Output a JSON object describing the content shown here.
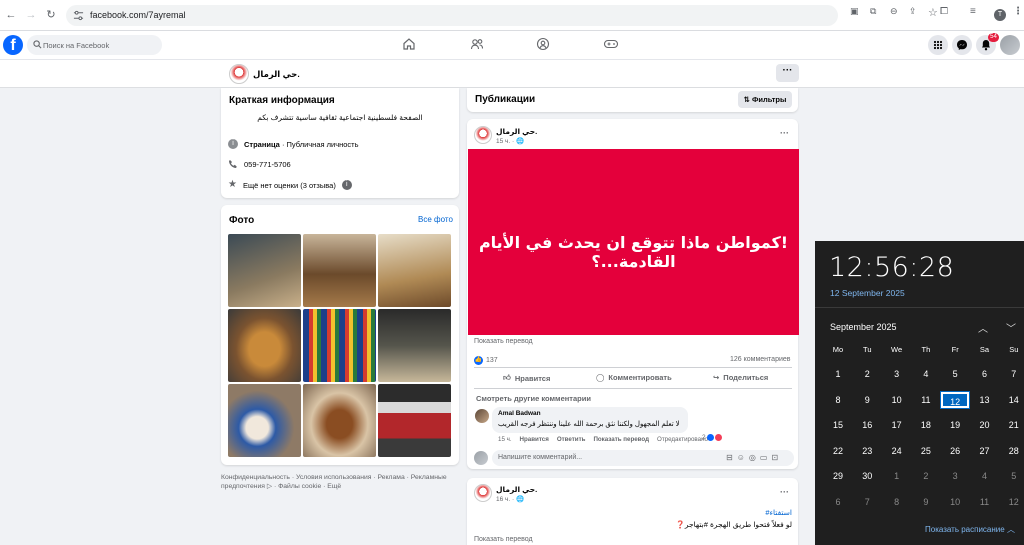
{
  "browser": {
    "url": "facebook.com/7ayremal",
    "profile_initial": "T"
  },
  "fb": {
    "search_placeholder": "Поиск на Facebook",
    "notifications_count": "54"
  },
  "page": {
    "name": "حي الرمال.",
    "more_label": "···"
  },
  "intro": {
    "title": "Краткая информация",
    "description": "الصفحة فلسطينية اجتماعية ثقافية ساسية تتشرف بكم",
    "category_bold": "Страница",
    "category_rest": " · Публичная личность",
    "phone": "059-771-5706",
    "rating": "Ещё нет оценки (3 отзыва)"
  },
  "photos": {
    "title": "Фото",
    "see_all": "Все фото"
  },
  "footer": {
    "text": "Конфиденциальность · Условия использования · Реклама · Рекламные предпочтения ▷ · Файлы cookie · Ещё"
  },
  "posts_header": {
    "title": "Публикации",
    "filters": "Фильтры"
  },
  "post1": {
    "author": "حي الرمال.",
    "time": "15 ч. · ",
    "banner_text": "!كمواطن ماذا تتوقع ان يحدث في الأيام القادمة...؟",
    "translate": "Показать перевод",
    "reactions": "137",
    "comments_count": "126 комментариев",
    "like": "Нравится",
    "comment": "Комментировать",
    "share": "Поделиться",
    "more_comments": "Смотреть другие комментарии",
    "comment_author": "Amal Badwan",
    "comment_text": "لا تعلم المجهول ولكننا نثق برحمة الله علينا وننتظر فرجه القريب",
    "comment_time": "15 ч.",
    "comment_like": "Нравится",
    "comment_reply": "Ответить",
    "comment_translate": "Показать перевод",
    "comment_edited": "Отредактировано",
    "comment_reacts": "2",
    "write_comment": "Напишите комментарий..."
  },
  "post2": {
    "author": "حي الرمال.",
    "time": "16 ч. · ",
    "hashtag": "#استفتاء",
    "text": "لو فعلاً فتحوا طريق الهجرة #بتهاجر❓",
    "translate": "Показать перевод"
  },
  "clock": {
    "time": "12:56:28",
    "date": "12 September 2025",
    "month": "September 2025",
    "weekdays": [
      "Mo",
      "Tu",
      "We",
      "Th",
      "Fr",
      "Sa",
      "Su"
    ],
    "rows": [
      [
        "1",
        "2",
        "3",
        "4",
        "5",
        "6",
        "7"
      ],
      [
        "8",
        "9",
        "10",
        "11",
        "12",
        "13",
        "14"
      ],
      [
        "15",
        "16",
        "17",
        "18",
        "19",
        "20",
        "21"
      ],
      [
        "22",
        "23",
        "24",
        "25",
        "26",
        "27",
        "28"
      ],
      [
        "29",
        "30",
        "1",
        "2",
        "3",
        "4",
        "5"
      ],
      [
        "6",
        "7",
        "8",
        "9",
        "10",
        "11",
        "12"
      ]
    ],
    "show_schedule": "Показать расписание"
  }
}
